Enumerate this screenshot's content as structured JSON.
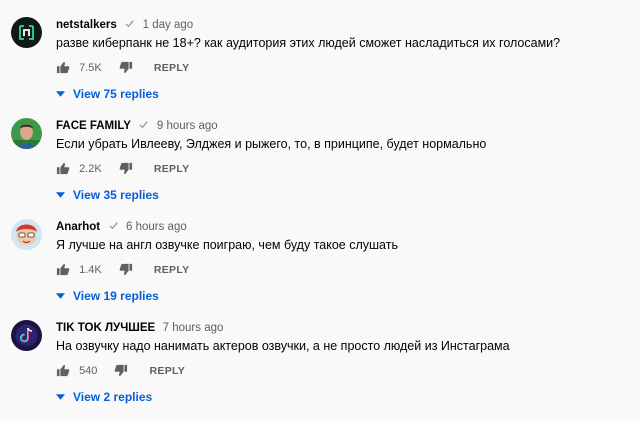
{
  "comments": [
    {
      "author": "netstalkers",
      "verified": true,
      "time": "1 day ago",
      "text": "разве киберпанк не 18+? как аудитория этих людей сможет насладиться их голосами?",
      "likes": "7.5K",
      "reply_label": "REPLY",
      "view_replies": "View 75 replies",
      "avatar_icon": "netstalkers-logo-icon"
    },
    {
      "author": "FACE FAMILY",
      "verified": true,
      "time": "9 hours ago",
      "text": "Если убрать Ивлееву, Элджея и рыжего, то, в принципе, будет нормально",
      "likes": "2.2K",
      "reply_label": "REPLY",
      "view_replies": "View 35 replies",
      "avatar_icon": "man-photo-icon"
    },
    {
      "author": "Anarhot",
      "verified": true,
      "time": "6 hours ago",
      "text": "Я лучше на англ озвучке поиграю, чем буду такое слушать",
      "likes": "1.4K",
      "reply_label": "REPLY",
      "view_replies": "View 19 replies",
      "avatar_icon": "cartoon-character-icon"
    },
    {
      "author": "TIK TOK ЛУЧШЕЕ",
      "verified": false,
      "time": "7 hours ago",
      "text": "На озвучку надо нанимать актеров озвучки, а не просто людей из Инстаграма",
      "likes": "540",
      "reply_label": "REPLY",
      "view_replies": "View 2 replies",
      "avatar_icon": "tiktok-logo-icon"
    }
  ],
  "colors": {
    "background": "#f9f9f9",
    "text": "#030303",
    "secondary": "#606060",
    "link": "#065fd4"
  }
}
